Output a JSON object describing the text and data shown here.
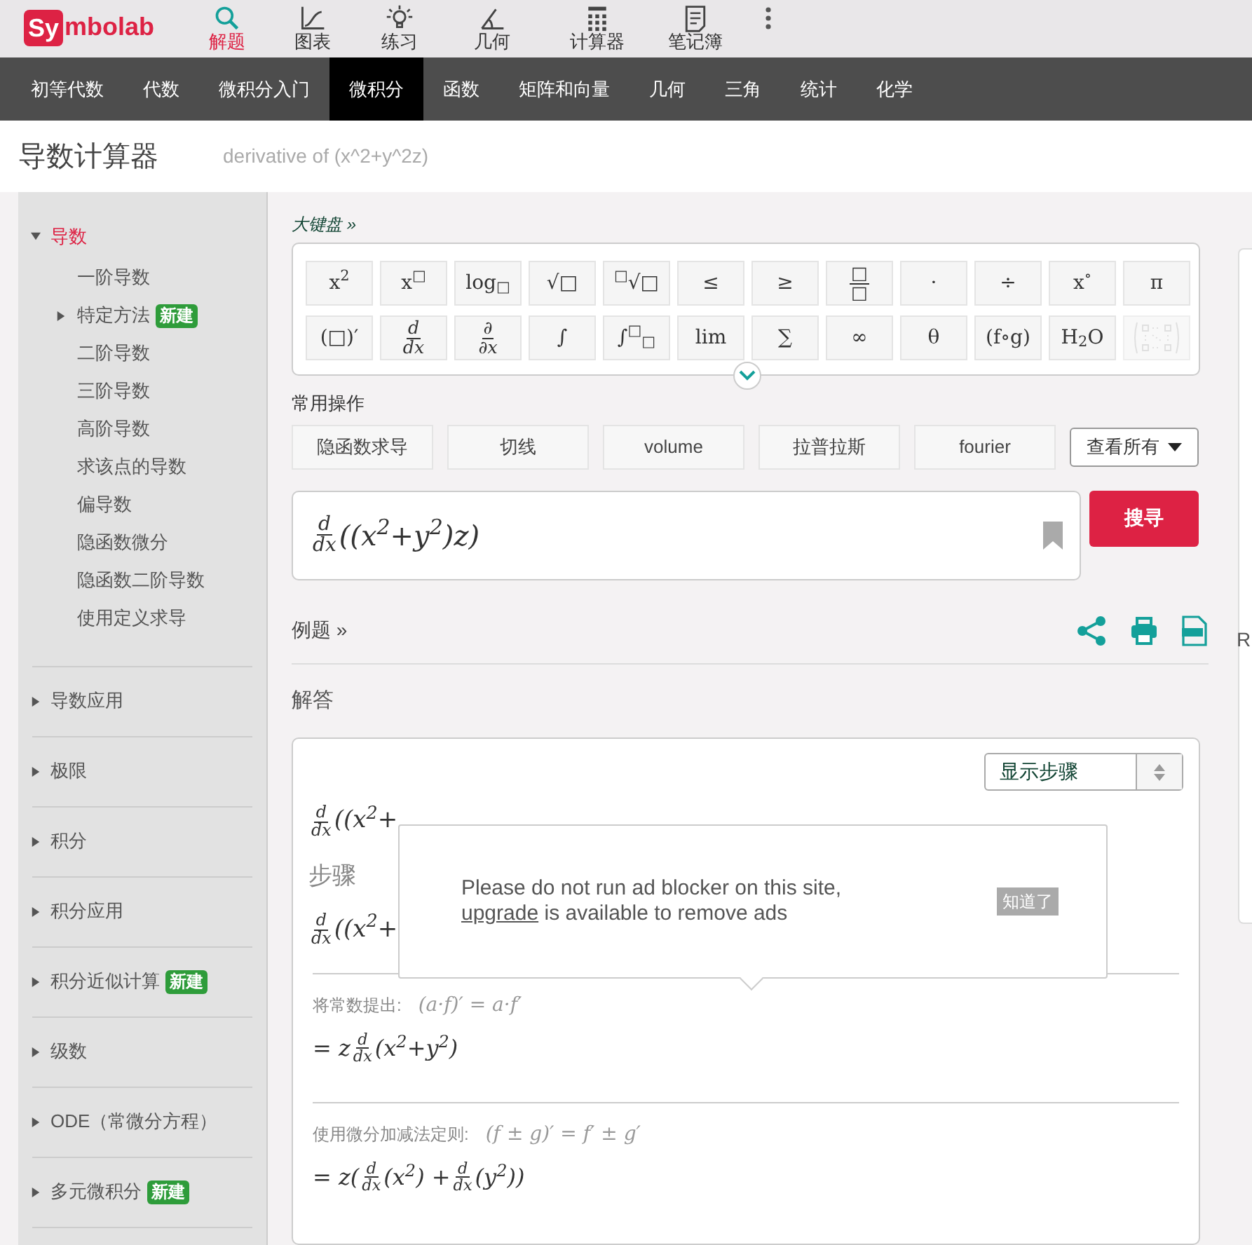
{
  "logo": {
    "badge": "Sy",
    "rest": "mbolab"
  },
  "top_nav": [
    {
      "label": "解题",
      "selected": true
    },
    {
      "label": "图表",
      "selected": false
    },
    {
      "label": "练习",
      "selected": false
    },
    {
      "label": "几何",
      "selected": false
    },
    {
      "label": "计算器",
      "selected": false
    },
    {
      "label": "笔记簿",
      "selected": false
    }
  ],
  "subject_nav": [
    {
      "label": "初等代数",
      "selected": false
    },
    {
      "label": "代数",
      "selected": false
    },
    {
      "label": "微积分入门",
      "selected": false
    },
    {
      "label": "微积分",
      "selected": true
    },
    {
      "label": "函数",
      "selected": false
    },
    {
      "label": "矩阵和向量",
      "selected": false
    },
    {
      "label": "几何",
      "selected": false
    },
    {
      "label": "三角",
      "selected": false
    },
    {
      "label": "统计",
      "selected": false
    },
    {
      "label": "化学",
      "selected": false
    }
  ],
  "page_title": "导数计算器",
  "query": "derivative of (x^2+y^2z)",
  "sidebar": [
    {
      "label": "导数",
      "expanded": true,
      "children": [
        {
          "label": "一阶导数"
        },
        {
          "label": "特定方法",
          "badge": "新建",
          "expandable": true
        },
        {
          "label": "二阶导数"
        },
        {
          "label": "三阶导数"
        },
        {
          "label": "高阶导数"
        },
        {
          "label": "求该点的导数"
        },
        {
          "label": "偏导数"
        },
        {
          "label": "隐函数微分"
        },
        {
          "label": "隐函数二阶导数"
        },
        {
          "label": "使用定义求导"
        }
      ]
    },
    {
      "label": "导数应用",
      "expanded": false
    },
    {
      "label": "极限",
      "expanded": false
    },
    {
      "label": "积分",
      "expanded": false
    },
    {
      "label": "积分应用",
      "expanded": false
    },
    {
      "label": "积分近似计算",
      "expanded": false,
      "badge": "新建"
    },
    {
      "label": "级数",
      "expanded": false
    },
    {
      "label": "ODE（常微分方程）",
      "expanded": false
    },
    {
      "label": "多元微积分",
      "expanded": false,
      "badge": "新建"
    }
  ],
  "keyboard": {
    "title": "大键盘 »",
    "keys": [
      {
        "kind": "text",
        "text": "x$^{2}$"
      },
      {
        "kind": "text",
        "text": "x$^{□}$"
      },
      {
        "kind": "text",
        "text": "log$_{□}$"
      },
      {
        "kind": "text",
        "text": "√□"
      },
      {
        "kind": "text",
        "text": "$^{□}$√□"
      },
      {
        "kind": "text",
        "text": "≤"
      },
      {
        "kind": "text",
        "text": "≥"
      },
      {
        "kind": "frac",
        "num": "□",
        "den": "□"
      },
      {
        "kind": "text",
        "text": "·"
      },
      {
        "kind": "text",
        "text": "÷"
      },
      {
        "kind": "text",
        "text": "x$^{∘}$"
      },
      {
        "kind": "text",
        "text": "π"
      },
      {
        "kind": "text",
        "text": "(□)′"
      },
      {
        "kind": "frac",
        "num": "d",
        "den": "dx"
      },
      {
        "kind": "frac",
        "num": "∂",
        "den": "∂x"
      },
      {
        "kind": "text",
        "text": "∫"
      },
      {
        "kind": "text",
        "text": "∫$^{□}$$_{□}$"
      },
      {
        "kind": "text",
        "text": "lim"
      },
      {
        "kind": "text",
        "text": "∑"
      },
      {
        "kind": "text",
        "text": "∞"
      },
      {
        "kind": "text",
        "text": "θ"
      },
      {
        "kind": "text",
        "text": "(f∘g)"
      },
      {
        "kind": "text",
        "text": "H$_{2}$O"
      },
      {
        "kind": "matrix",
        "disabled": true
      }
    ]
  },
  "common_ops": {
    "title": "常用操作",
    "buttons": [
      "隐函数求导",
      "切线",
      "volume",
      "拉普拉斯",
      "fourier"
    ],
    "more": "查看所有"
  },
  "input": [
    {
      "kind": "frac",
      "num": "d",
      "den": "dx"
    },
    {
      "kind": "text",
      "text": "((x$^{2}$+y$^{2}$)z)"
    }
  ],
  "search_button": "搜寻",
  "examples_link": "例题 »",
  "solution_title": "解答",
  "steps_select": "显示步骤",
  "result_line": [
    {
      "kind": "frac",
      "num": "d",
      "den": "dx"
    },
    {
      "kind": "text",
      "text": "((x$^{2}$+"
    }
  ],
  "steps_title": "步骤",
  "steps_line": [
    {
      "kind": "frac",
      "num": "d",
      "den": "dx"
    },
    {
      "kind": "text",
      "text": "((x$^{2}$+"
    }
  ],
  "steps": [
    {
      "rule": "将常数提出:",
      "formula": "(a·f)′ = a·f′",
      "result": [
        {
          "kind": "text",
          "text": "= z"
        },
        {
          "kind": "frac",
          "num": "d",
          "den": "dx"
        },
        {
          "kind": "text",
          "text": "(x$^{2}$+y$^{2}$)"
        }
      ]
    },
    {
      "rule": "使用微分加减法定则:",
      "formula": "(f ± g)′ = f′ ± g′",
      "result": [
        {
          "kind": "text",
          "text": "= z("
        },
        {
          "kind": "frac",
          "num": "d",
          "den": "dx"
        },
        {
          "kind": "text",
          "text": "(x$^{2}$) +"
        },
        {
          "kind": "frac",
          "num": "d",
          "den": "dx"
        },
        {
          "kind": "text",
          "text": "(y$^{2}$))"
        }
      ]
    }
  ],
  "ad_popup": {
    "line1": "Please do not run ad blocker on this site,",
    "link": "upgrade",
    "line2": " is available to remove ads",
    "button": "知道了"
  },
  "right_panel": {
    "text": "R"
  }
}
